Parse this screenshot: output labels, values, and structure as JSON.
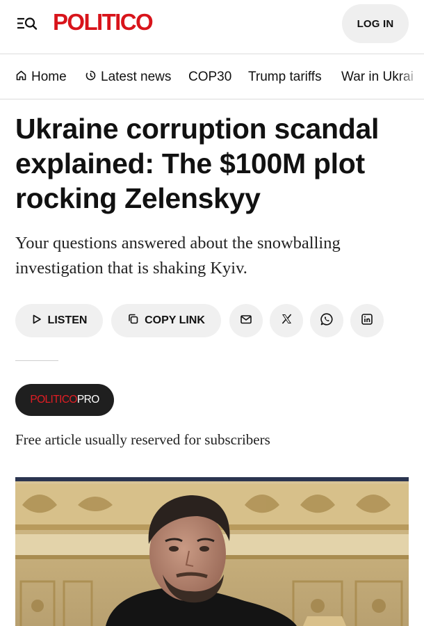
{
  "header": {
    "logo_text": "POLITICO",
    "login_label": "LOG IN",
    "menu_icon": "menu-search-icon",
    "brand_color": "#d8141b"
  },
  "nav": {
    "items": [
      {
        "label": "Home",
        "icon": "home-icon"
      },
      {
        "label": "Latest news",
        "icon": "clock-icon"
      },
      {
        "label": "COP30"
      },
      {
        "label": "Trump tariffs"
      },
      {
        "label": "War in Ukrai"
      }
    ]
  },
  "article": {
    "headline": "Ukraine corruption scandal explained: The $100M plot rocking Zelenskyy",
    "dek": "Your questions answered about the snowballing investigation that is shaking Kyiv.",
    "share": {
      "listen_label": "LISTEN",
      "copy_link_label": "COPY LINK",
      "icons": [
        "email-icon",
        "x-icon",
        "whatsapp-icon",
        "linkedin-icon"
      ]
    },
    "pro_badge": {
      "part1": "POLITICO",
      "part2": "PRO"
    },
    "free_note": "Free article usually reserved for subscribers",
    "image": {
      "subject": "man-at-ornate-gilded-room"
    }
  }
}
